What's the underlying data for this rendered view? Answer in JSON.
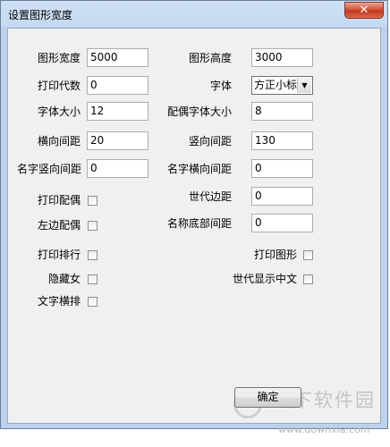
{
  "window": {
    "title": "设置图形宽度",
    "close_glyph": "✕"
  },
  "fields": {
    "graph_width": {
      "label": "图形宽度",
      "value": "5000"
    },
    "graph_height": {
      "label": "图形高度",
      "value": "3000"
    },
    "print_generation": {
      "label": "打印代数",
      "value": "0"
    },
    "font": {
      "label": "字体",
      "value": "方正小标"
    },
    "font_size": {
      "label": "字体大小",
      "value": "12"
    },
    "spouse_font_size": {
      "label": "配偶字体大小",
      "value": "8"
    },
    "horizontal_spacing": {
      "label": "横向间距",
      "value": "20"
    },
    "vertical_spacing": {
      "label": "竖向间距",
      "value": "130"
    },
    "name_vertical_spacing": {
      "label": "名字竖向间距",
      "value": "0"
    },
    "name_horizontal_spacing": {
      "label": "名字横向间距",
      "value": "0"
    },
    "generation_margin": {
      "label": "世代边距",
      "value": "0"
    },
    "name_bottom_spacing": {
      "label": "名称底部间距",
      "value": "0"
    }
  },
  "checkboxes": {
    "print_spouse": {
      "label": "打印配偶",
      "checked": false
    },
    "left_spouse": {
      "label": "左边配偶",
      "checked": false
    },
    "print_rank": {
      "label": "打印排行",
      "checked": false
    },
    "print_graph": {
      "label": "打印图形",
      "checked": false
    },
    "hide_female": {
      "label": "隐藏女",
      "checked": false
    },
    "show_generation_chinese": {
      "label": "世代显示中文",
      "checked": false
    },
    "text_horizontal": {
      "label": "文字横排",
      "checked": false
    }
  },
  "buttons": {
    "ok": "确定"
  },
  "watermark": {
    "brand": "当下软件园",
    "url": "www.downxia.com"
  }
}
